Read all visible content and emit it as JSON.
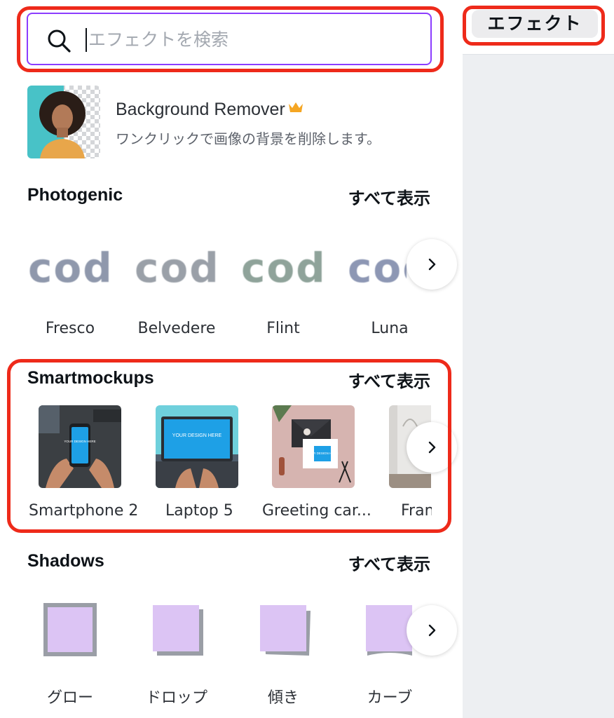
{
  "search": {
    "placeholder": "エフェクトを検索"
  },
  "right_panel": {
    "tab_label": "エフェクト"
  },
  "background_remover": {
    "title": "Background Remover",
    "subtitle": "ワンクリックで画像の背景を削除します。",
    "badge_icon": "crown-icon",
    "badge_color": "#f5a623"
  },
  "sections": [
    {
      "title": "Photogenic",
      "see_all": "すべて表示",
      "preview_text": "cod",
      "items": [
        {
          "label": "Fresco",
          "color": "#8f98ac"
        },
        {
          "label": "Belvedere",
          "color": "#9aa0a8"
        },
        {
          "label": "Flint",
          "color": "#8fa39a"
        },
        {
          "label": "Luna",
          "color": "#8d97b4"
        }
      ]
    },
    {
      "title": "Smartmockups",
      "see_all": "すべて表示",
      "items": [
        {
          "label": "Smartphone 2",
          "screen_text": "YOUR DESIGN HERE"
        },
        {
          "label": "Laptop 5",
          "screen_text": "YOUR DESIGN HERE"
        },
        {
          "label": "Greeting car...",
          "screen_text": "YOUR DESIGN HERE"
        },
        {
          "label": "Fran"
        }
      ]
    },
    {
      "title": "Shadows",
      "see_all": "すべて表示",
      "items": [
        {
          "label": "グロー"
        },
        {
          "label": "ドロップ"
        },
        {
          "label": "傾き"
        },
        {
          "label": "カーブ"
        }
      ]
    }
  ],
  "colors": {
    "accent_purple": "#8b3dff",
    "highlight_red": "#ee2a1a",
    "shadow_fill": "#dcc4f4",
    "shadow_gray": "#9a9ea6"
  }
}
